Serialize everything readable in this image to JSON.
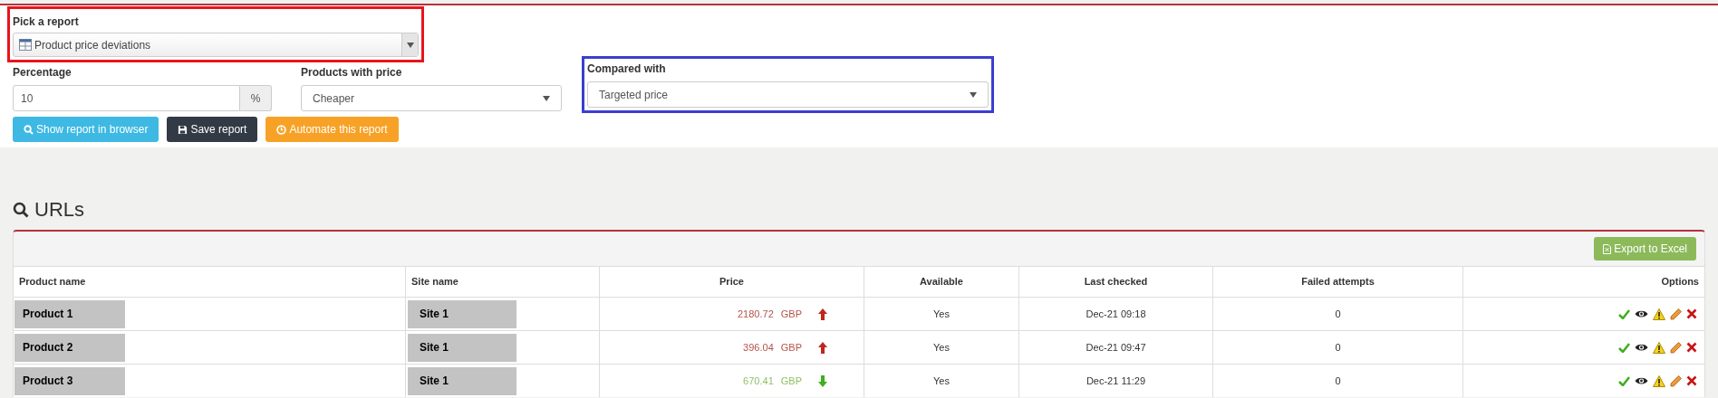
{
  "report_picker": {
    "label": "Pick a report",
    "value": "Product price deviations",
    "color": "#e8141c"
  },
  "filters": [
    {
      "kind": "addon",
      "label": "Percentage",
      "value": "10",
      "addon": "%"
    },
    {
      "kind": "select",
      "label": "Products with price",
      "value": "Cheaper"
    },
    {
      "kind": "select",
      "label": "Compared with",
      "value": "Targeted price",
      "color": "#3b3fd0"
    }
  ],
  "buttons": [
    {
      "kind": "search",
      "label": "Show report in browser",
      "color": "#3db9e3"
    },
    {
      "kind": "save",
      "label": "Save report",
      "color": "#323a45"
    },
    {
      "kind": "clock",
      "label": "Automate this report",
      "color": "#f7a226"
    }
  ],
  "section_title": "URLs",
  "export_button": "Export to Excel",
  "table": {
    "columns": [
      "Product name",
      "Site name",
      "Price",
      "Available",
      "Last checked",
      "Failed attempts",
      "Options"
    ],
    "rows": [
      {
        "product": "Product 1",
        "site": "Site 1",
        "price": "2180.72",
        "currency": "GBP",
        "rising": true,
        "available": "Yes",
        "last_checked": "Dec-21 09:18",
        "failed": "0"
      },
      {
        "product": "Product 2",
        "site": "Site 1",
        "price": "396.04",
        "currency": "GBP",
        "rising": true,
        "available": "Yes",
        "last_checked": "Dec-21 09:47",
        "failed": "0"
      },
      {
        "product": "Product 3",
        "site": "Site 1",
        "price": "670.41",
        "currency": "GBP",
        "rising": false,
        "available": "Yes",
        "last_checked": "Dec-21 11:29",
        "failed": "0"
      }
    ]
  }
}
